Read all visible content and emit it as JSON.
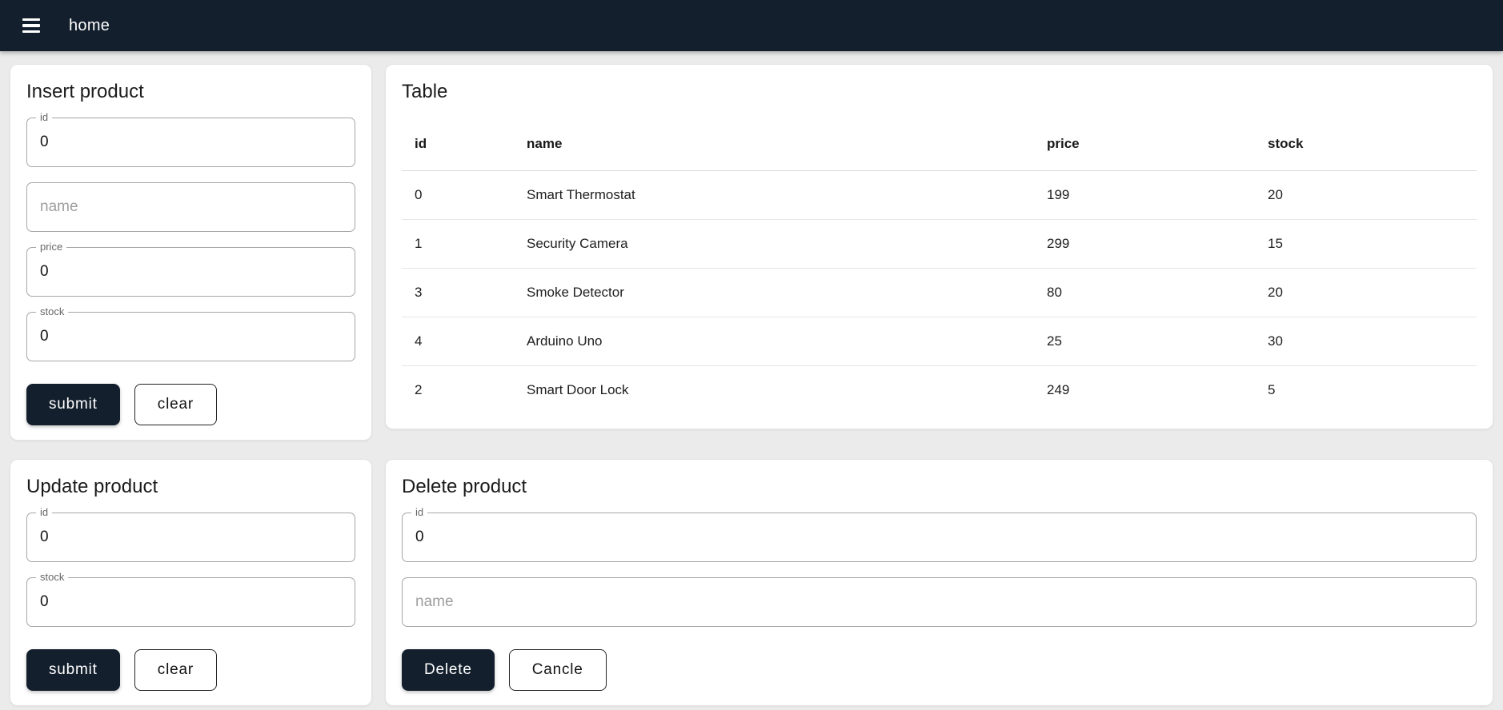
{
  "header": {
    "title": "home",
    "menu_icon": "hamburger-menu-icon"
  },
  "insert_card": {
    "title": "Insert product",
    "id_field": {
      "label": "id",
      "value": "0"
    },
    "name_field": {
      "placeholder": "name"
    },
    "price_field": {
      "label": "price",
      "value": "0"
    },
    "stock_field": {
      "label": "stock",
      "value": "0"
    },
    "submit_label": "submit",
    "clear_label": "clear"
  },
  "table_card": {
    "title": "Table",
    "columns": [
      "id",
      "name",
      "price",
      "stock"
    ],
    "rows": [
      [
        "0",
        "Smart Thermostat",
        "199",
        "20"
      ],
      [
        "1",
        "Security Camera",
        "299",
        "15"
      ],
      [
        "3",
        "Smoke Detector",
        "80",
        "20"
      ],
      [
        "4",
        "Arduino Uno",
        "25",
        "30"
      ],
      [
        "2",
        "Smart Door Lock",
        "249",
        "5"
      ]
    ]
  },
  "update_card": {
    "title": "Update product",
    "id_field": {
      "label": "id",
      "value": "0"
    },
    "stock_field": {
      "label": "stock",
      "value": "0"
    },
    "submit_label": "submit",
    "clear_label": "clear"
  },
  "delete_card": {
    "title": "Delete product",
    "id_field": {
      "label": "id",
      "value": "0"
    },
    "name_field": {
      "placeholder": "name"
    },
    "delete_label": "Delete",
    "cancel_label": "Cancle"
  },
  "colors": {
    "appbar_bg": "#131f2d",
    "primary_button_bg": "#131f2d",
    "page_bg": "#ebebeb",
    "card_bg": "#ffffff"
  }
}
